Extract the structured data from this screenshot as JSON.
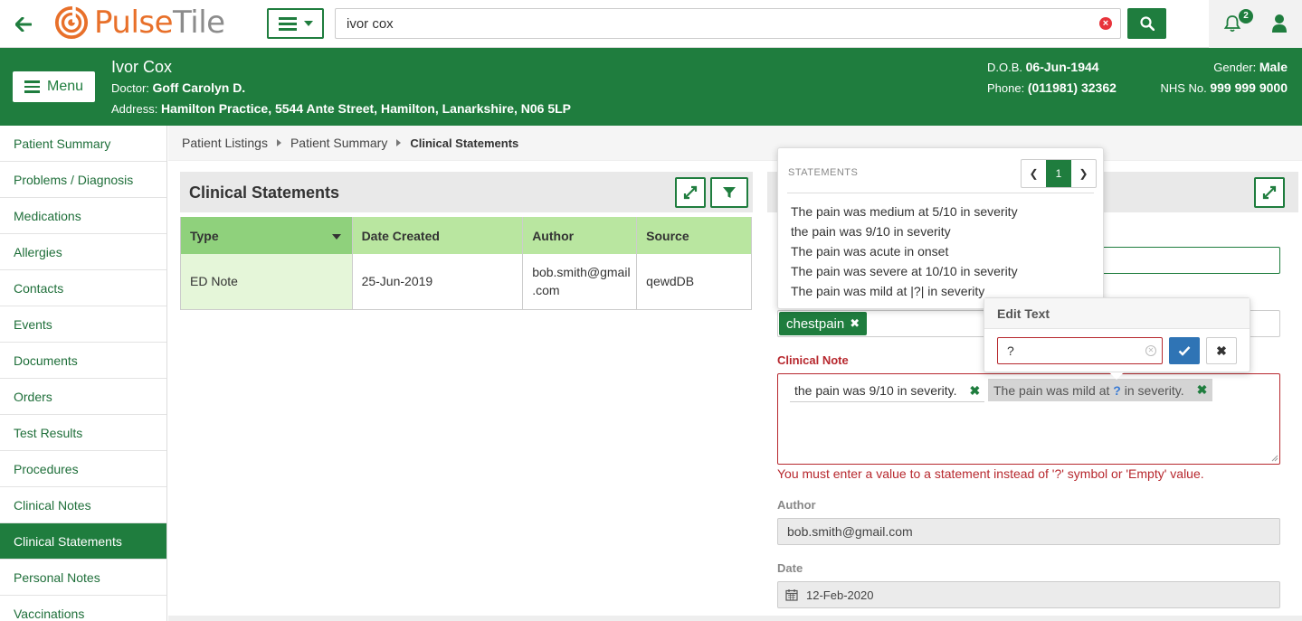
{
  "app": {
    "logo_pulse": "Pulse",
    "logo_tile": "Tile",
    "accent": "#1f7d3e",
    "logo_color": "#e8702a"
  },
  "topbar": {
    "back_icon": "arrow-left-icon",
    "search_value": "ivor cox",
    "notification_count": "2"
  },
  "patient": {
    "name": "Ivor Cox",
    "doctor_label": "Doctor:",
    "doctor": "Goff Carolyn D.",
    "address_label": "Address:",
    "address": "Hamilton Practice, 5544 Ante Street, Hamilton, Lanarkshire, N06 5LP",
    "dob_label": "D.O.B.",
    "dob": "06-Jun-1944",
    "phone_label": "Phone:",
    "phone": "(011981) 32362",
    "gender_label": "Gender:",
    "gender": "Male",
    "nhs_label": "NHS No.",
    "nhs": "999 999 9000",
    "menu_label": "Menu"
  },
  "sidebar": {
    "items": [
      {
        "label": "Patient Summary"
      },
      {
        "label": "Problems / Diagnosis"
      },
      {
        "label": "Medications"
      },
      {
        "label": "Allergies"
      },
      {
        "label": "Contacts"
      },
      {
        "label": "Events"
      },
      {
        "label": "Documents"
      },
      {
        "label": "Orders"
      },
      {
        "label": "Test Results"
      },
      {
        "label": "Procedures"
      },
      {
        "label": "Clinical Notes"
      },
      {
        "label": "Clinical Statements"
      },
      {
        "label": "Personal Notes"
      },
      {
        "label": "Vaccinations"
      }
    ],
    "active_index": 11
  },
  "breadcrumb": {
    "items": [
      "Patient Listings",
      "Patient Summary",
      "Clinical Statements"
    ]
  },
  "list_panel": {
    "title": "Clinical Statements",
    "columns": [
      "Type",
      "Date Created",
      "Author",
      "Source"
    ],
    "rows": [
      {
        "type": "ED Note",
        "date": "25-Jun-2019",
        "author_l1": "bob.smith@gmail",
        "author_l2": ".com",
        "source": "qewdDB"
      }
    ]
  },
  "form": {
    "tag": "chestpain",
    "clinical_note_label": "Clinical Note",
    "statement1": "the pain was 9/10 in severity.",
    "statement2_pre": "The pain was mild at",
    "statement2_q": "?",
    "statement2_post": "in severity.",
    "error": "You must enter a value to a statement instead of '?' symbol or 'Empty' value.",
    "author_label": "Author",
    "author": "bob.smith@gmail.com",
    "date_label": "Date",
    "date": "12-Feb-2020"
  },
  "statements_popup": {
    "title": "STATEMENTS",
    "page": "1",
    "prev": "❮",
    "next": "❯",
    "items": [
      "The pain was medium at 5/10 in severity",
      "the pain was 9/10 in severity",
      "The pain was acute in onset",
      "The pain was severe at 10/10 in severity",
      "The pain was mild at |?| in severity"
    ]
  },
  "edit_popup": {
    "title": "Edit Text",
    "value": "?"
  }
}
